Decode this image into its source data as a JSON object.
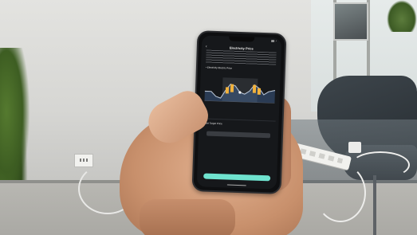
{
  "photo": {
    "subject": "hand holding smartphone",
    "colors": {
      "accent": "#6fe3cf",
      "screen_bg": "#16181b",
      "chart_line": "#cfd3d9",
      "bar": "#f2b23c"
    }
  },
  "phone_screen": {
    "status_time": "",
    "nav_title": "Electricity Price",
    "section_price_title": "• Electricity Electric Price",
    "current_price": "",
    "legend": [
      "",
      "",
      ""
    ],
    "toggle_label": "",
    "section_target_title": "• Set Target Price",
    "row1_label": "",
    "row1_button": "",
    "row2_label": "",
    "next_button": ""
  },
  "icons": {
    "back": "back-arrow-icon"
  }
}
